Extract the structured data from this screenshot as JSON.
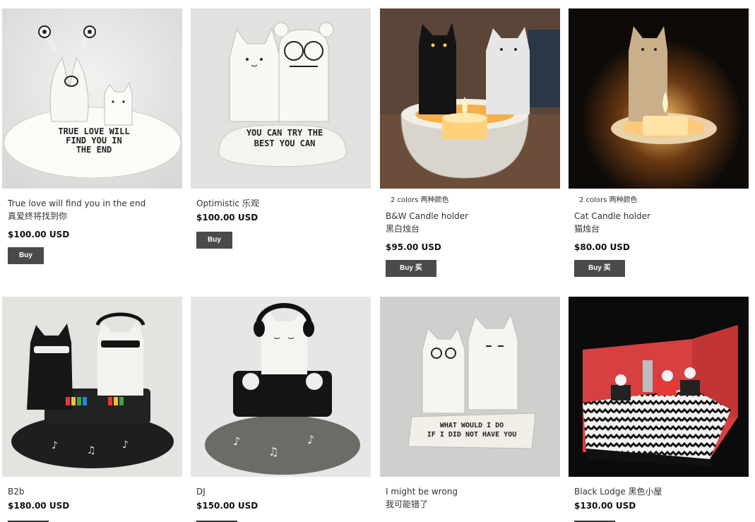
{
  "products": [
    {
      "note": "",
      "title": "True love will find you in the end",
      "title_cn": "真爱终将找到你",
      "price": "$100.00 USD",
      "buy": "Buy",
      "plaque": [
        "TRUE LOVE WILL",
        "FIND YOU IN",
        "THE END"
      ]
    },
    {
      "note": "",
      "title": "Optimistic 乐观",
      "title_cn": "",
      "price": "$100.00 USD",
      "buy": "Buy",
      "plaque": [
        "YOU CAN TRY THE",
        "BEST YOU CAN"
      ]
    },
    {
      "note": "2 colors 两种颜色",
      "title": "B&W Candle holder",
      "title_cn": "黑白烛台",
      "price": "$95.00 USD",
      "buy": "Buy 买"
    },
    {
      "note": "2 colors 两种颜色",
      "title": "Cat Candle holder",
      "title_cn": "猫烛台",
      "price": "$80.00 USD",
      "buy": "Buy 买"
    },
    {
      "note": "",
      "title": "B2b",
      "title_cn": "",
      "price": "$180.00 USD"
    },
    {
      "note": "",
      "title": "DJ",
      "title_cn": "",
      "price": "$150.00 USD"
    },
    {
      "note": "",
      "title": "I might be wrong",
      "title_cn": "我可能错了",
      "price": "",
      "plaque": [
        "WHAT WOULD I DO",
        "IF I DID NOT HAVE YOU"
      ]
    },
    {
      "note": "",
      "title": "Black Lodge 黑色小屋",
      "title_cn": "",
      "price": "$130.00 USD"
    }
  ]
}
